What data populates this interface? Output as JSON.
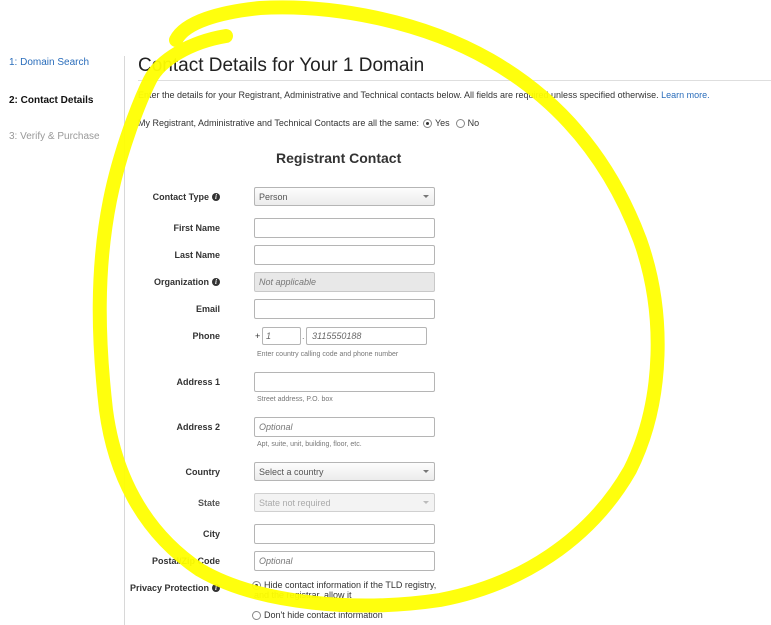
{
  "steps": {
    "step1": "1: Domain Search",
    "step2": "2: Contact Details",
    "step3": "3: Verify & Purchase"
  },
  "page": {
    "title": "Contact Details for Your 1 Domain",
    "intro": "Enter the details for your Registrant, Administrative and Technical contacts below. All fields are required unless specified otherwise.",
    "learn_more": "Learn more.",
    "same_text": "My Registrant, Administrative and Technical Contacts are all the same:",
    "same_yes": "Yes",
    "same_no": "No",
    "same_selected": "Yes"
  },
  "form": {
    "section_title": "Registrant Contact",
    "contact_type": {
      "label": "Contact Type",
      "value": "Person",
      "info_icon": "info-icon"
    },
    "first_name": {
      "label": "First Name",
      "value": ""
    },
    "last_name": {
      "label": "Last Name",
      "value": ""
    },
    "organization": {
      "label": "Organization",
      "placeholder": "Not applicable",
      "info_icon": "info-icon"
    },
    "email": {
      "label": "Email",
      "value": ""
    },
    "phone": {
      "label": "Phone",
      "plus": "+",
      "country_code_placeholder": "1",
      "separator": ".",
      "number_placeholder": "3115550188",
      "hint": "Enter country calling code and phone number"
    },
    "address1": {
      "label": "Address 1",
      "value": "",
      "hint": "Street address, P.O. box"
    },
    "address2": {
      "label": "Address 2",
      "placeholder": "Optional",
      "hint": "Apt, suite, unit, building, floor, etc."
    },
    "country": {
      "label": "Country",
      "value": "Select a country"
    },
    "state": {
      "label": "State",
      "value": "State not required"
    },
    "city": {
      "label": "City",
      "value": ""
    },
    "postal": {
      "label": "Postal/Zip Code",
      "placeholder": "Optional"
    },
    "privacy": {
      "label": "Privacy Protection",
      "option_hide_line1": "Hide contact information if the TLD registry,",
      "option_hide_line2": "and the registrar, allow it",
      "option_show": "Don't hide contact information",
      "selected": "hide"
    }
  },
  "annotation": {
    "color": "#ffff00"
  }
}
